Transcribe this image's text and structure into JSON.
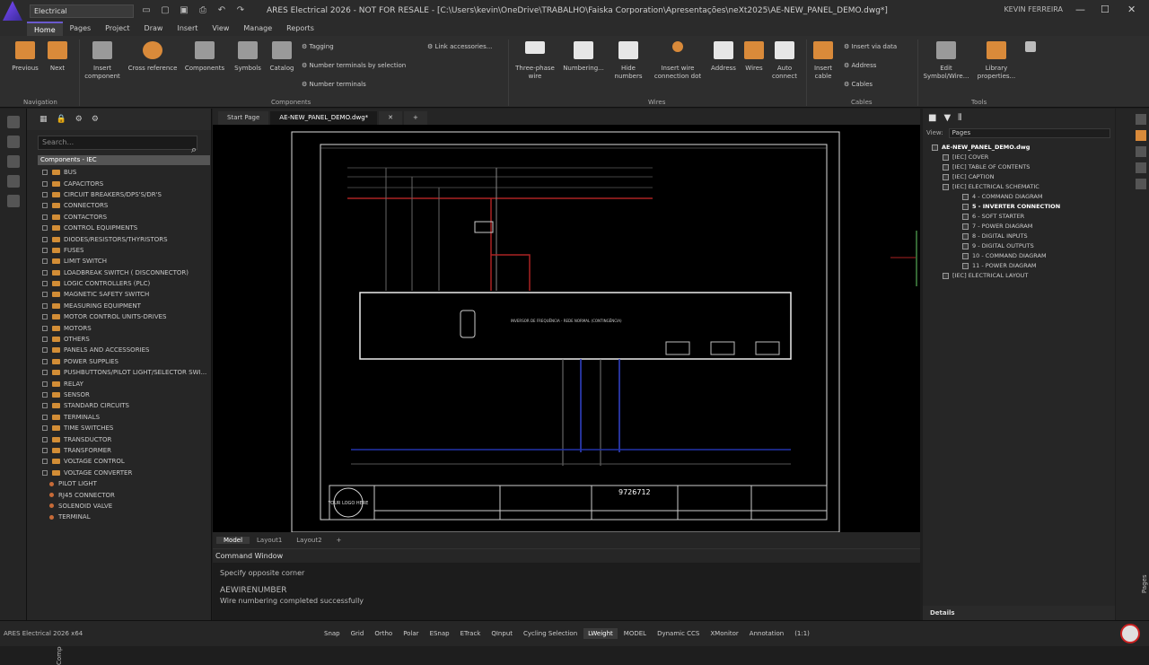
{
  "titlebar": {
    "workspace": "Electrical",
    "title": "ARES Electrical 2026 - NOT FOR RESALE - [C:\\Users\\kevin\\OneDrive\\TRABALHO\\Faiska Corporation\\Apresentações\\neXt2025\\AE-NEW_PANEL_DEMO.dwg*]",
    "user": "KEVIN FERREIRA"
  },
  "menus": [
    "Home",
    "Pages",
    "Project",
    "Draw",
    "Insert",
    "View",
    "Manage",
    "Reports"
  ],
  "ribbon": {
    "navigation": {
      "group": "Navigation",
      "previous": "Previous",
      "next": "Next"
    },
    "components": {
      "group": "Components",
      "insert": "Insert component",
      "crossref": "Cross reference",
      "components": "Components",
      "symbols": "Symbols",
      "catalog": "Catalog",
      "tagging": "Tagging",
      "numsel": "Number terminals by selection",
      "numterm": "Number terminals",
      "link": "Link accessories..."
    },
    "wires": {
      "group": "Wires",
      "three": "Three-phase wire",
      "numbering": "Numbering...",
      "hide": "Hide numbers",
      "insertdot": "Insert wire connection dot",
      "address": "Address",
      "wires": "Wires",
      "autoconnect": "Auto connect"
    },
    "cables": {
      "group": "Cables",
      "insertcable": "Insert cable",
      "insertvia": "Insert via data",
      "address": "Address",
      "cables": "Cables"
    },
    "tools": {
      "group": "Tools",
      "edit": "Edit Symbol/Wire...",
      "library": "Library properties..."
    }
  },
  "components_panel": {
    "search_placeholder": "Search...",
    "root": "Components - IEC",
    "vtab": "Components",
    "folders": [
      "BUS",
      "CAPACITORS",
      "CIRCUIT BREAKERS/DPS'S/DR'S",
      "CONNECTORS",
      "CONTACTORS",
      "CONTROL EQUIPMENTS",
      "DIODES/RESISTORS/THYRISTORS",
      "FUSES",
      "LIMIT SWITCH",
      "LOADBREAK SWITCH ( DISCONNECTOR)",
      "LOGIC CONTROLLERS (PLC)",
      "MAGNETIC SAFETY SWITCH",
      "MEASURING EQUIPMENT",
      "MOTOR CONTROL UNITS-DRIVES",
      "MOTORS",
      "OTHERS",
      "PANELS AND ACCESSORIES",
      "POWER SUPPLIES",
      "PUSHBUTTONS/PILOT LIGHT/SELECTOR SWI...",
      "RELAY",
      "SENSOR",
      "STANDARD CIRCUITS",
      "TERMINALS",
      "TIME SWITCHES",
      "TRANSDUCTOR",
      "TRANSFORMER",
      "VOLTAGE CONTROL",
      "VOLTAGE CONVERTER"
    ],
    "items": [
      "PILOT LIGHT",
      "RJ45 CONNECTOR",
      "SOLENOID VALVE",
      "TERMINAL"
    ]
  },
  "doc_tabs": [
    "Start Page",
    "AE-NEW_PANEL_DEMO.dwg*"
  ],
  "layout_tabs": [
    "Model",
    "Layout1",
    "Layout2"
  ],
  "drawing": {
    "inverter_text": "INVERSOR DE FREQUÊNCIA - REDE NORMAL (CONTINGÊNCIA)",
    "logo": "YOUR LOGO HERE",
    "number": "9726712"
  },
  "command": {
    "title": "Command Window",
    "line1": "Specify opposite corner",
    "line2": "AEWIRENUMBER",
    "line3": "Wire numbering completed successfully"
  },
  "pages_panel": {
    "view_label": "View:",
    "view_value": "Pages",
    "root": "AE-NEW_PANEL_DEMO.dwg",
    "sections": [
      "[IEC] COVER",
      "[IEC] TABLE OF CONTENTS",
      "[IEC] CAPTION",
      "[IEC] ELECTRICAL SCHEMATIC"
    ],
    "pages": [
      "4 - COMMAND DIAGRAM",
      "5 - INVERTER CONNECTION",
      "6 - SOFT STARTER",
      "7 - POWER DIAGRAM",
      "8 - DIGITAL INPUTS",
      "9 - DIGITAL OUTPUTS",
      "10 - COMMAND DIAGRAM",
      "11 - POWER DIAGRAM"
    ],
    "last": "[IEC] ELECTRICAL LAYOUT",
    "details": "Details",
    "vtab": "Pages"
  },
  "status": {
    "app": "ARES Electrical 2026 x64",
    "toggles": [
      "Snap",
      "Grid",
      "Ortho",
      "Polar",
      "ESnap",
      "ETrack",
      "QInput",
      "Cycling Selection",
      "LWeight",
      "MODEL",
      "Dynamic CCS",
      "XMonitor",
      "Annotation"
    ],
    "scale": "(1:1)"
  }
}
